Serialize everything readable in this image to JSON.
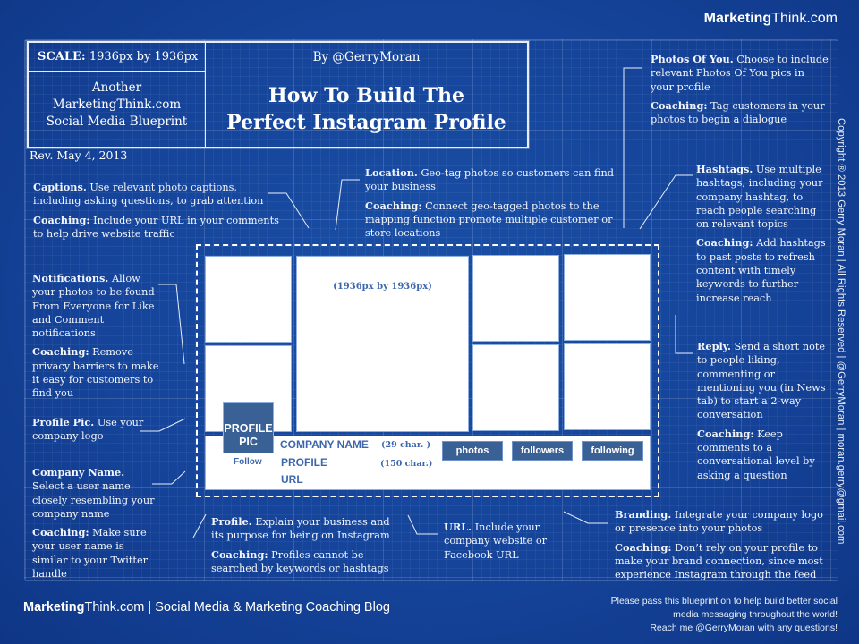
{
  "brand": {
    "bold": "Marketing",
    "rest": "Think.com"
  },
  "title_block": {
    "scale_label": "SCALE:",
    "scale_value": "1936px by 1936px",
    "another_lines": [
      "Another",
      "MarketingThink.com",
      "Social Media Blueprint"
    ],
    "byline": "By @GerryMoran",
    "title_lines": [
      "How To Build The",
      "Perfect Instagram Profile"
    ]
  },
  "revision": "Rev. May 4, 2013",
  "notes": {
    "captions": {
      "head": "Captions.",
      "text": "Use relevant  photo captions, including asking questions, to grab attention",
      "coach_head": "Coaching:",
      "coach_text": "Include your URL in your comments to help drive website traffic"
    },
    "location": {
      "head": "Location.",
      "text": "Geo-tag photos so customers can find your business",
      "coach_head": "Coaching:",
      "coach_text": "Connect geo-tagged photos to the mapping function promote multiple customer or store locations"
    },
    "photos_of_you": {
      "head": "Photos Of You.",
      "text": "Choose to include relevant Photos Of You pics in your profile",
      "coach_head": "Coaching:",
      "coach_text": "Tag customers in your photos to begin a dialogue"
    },
    "hashtags": {
      "head": "Hashtags.",
      "text": "Use  multiple hashtags, including your company hashtag, to reach people searching on relevant topics",
      "coach_head": "Coaching:",
      "coach_text": "Add hashtags to past posts to refresh content with timely keywords to further increase reach"
    },
    "notifications": {
      "head": "Notifications.",
      "text": "Allow your photos to be found From Everyone for Like and Comment notifications",
      "coach_head": "Coaching:",
      "coach_text": "Remove privacy barriers to make it easy for customers to find you"
    },
    "profile_pic": {
      "head": "Profile Pic.",
      "text": "Use your company logo"
    },
    "company_name": {
      "head": "Company Name.",
      "text": "Select a user name closely resembling your company name",
      "coach_head": "Coaching:",
      "coach_text": "Make sure your user name is similar to your Twitter handle"
    },
    "reply": {
      "head": "Reply.",
      "text": " Send a short note to people liking, commenting  or mentioning you (in News tab) to start a 2-way conversation",
      "coach_head": "Coaching:",
      "coach_text": "Keep comments to a conversational level by asking a question"
    },
    "profile": {
      "head": "Profile.",
      "text": "Explain your business and its purpose for being on Instagram",
      "coach_head": "Coaching:",
      "coach_text": "Profiles cannot be searched by keywords or hashtags"
    },
    "url": {
      "head": "URL.",
      "text": "Include your company website or Facebook URL"
    },
    "branding": {
      "head": "Branding.",
      "text": "Integrate your company logo or presence into your photos",
      "coach_head": "Coaching:",
      "coach_text": "Don’t rely on your profile to make your brand connection, since most experience Instagram through the feed"
    }
  },
  "mockup": {
    "big_photo_label": "(1936px by 1936px)",
    "profile_pic_lines": [
      "PROFILE",
      "PIC"
    ],
    "follow": "Follow",
    "company_name": "COMPANY NAME",
    "company_name_hint": "(29 char. )",
    "profile": "PROFILE",
    "profile_hint": "(150 char.)",
    "url": "URL",
    "buttons": [
      "photos",
      "followers",
      "following"
    ]
  },
  "copyright_vertical": "Copyright ® 2013 Gerry Moran | All Rights Reserved | @GerryMoran | moran.gerry@gmail.com",
  "footer": {
    "brand_bold": "Marketing",
    "brand_rest": "Think.com | Social Media & Marketing Coaching Blog",
    "right_lines": [
      "Please pass this blueprint on to help build  better social",
      "media messaging throughout the world!",
      "Reach me @GerryMoran with any questions!"
    ]
  }
}
